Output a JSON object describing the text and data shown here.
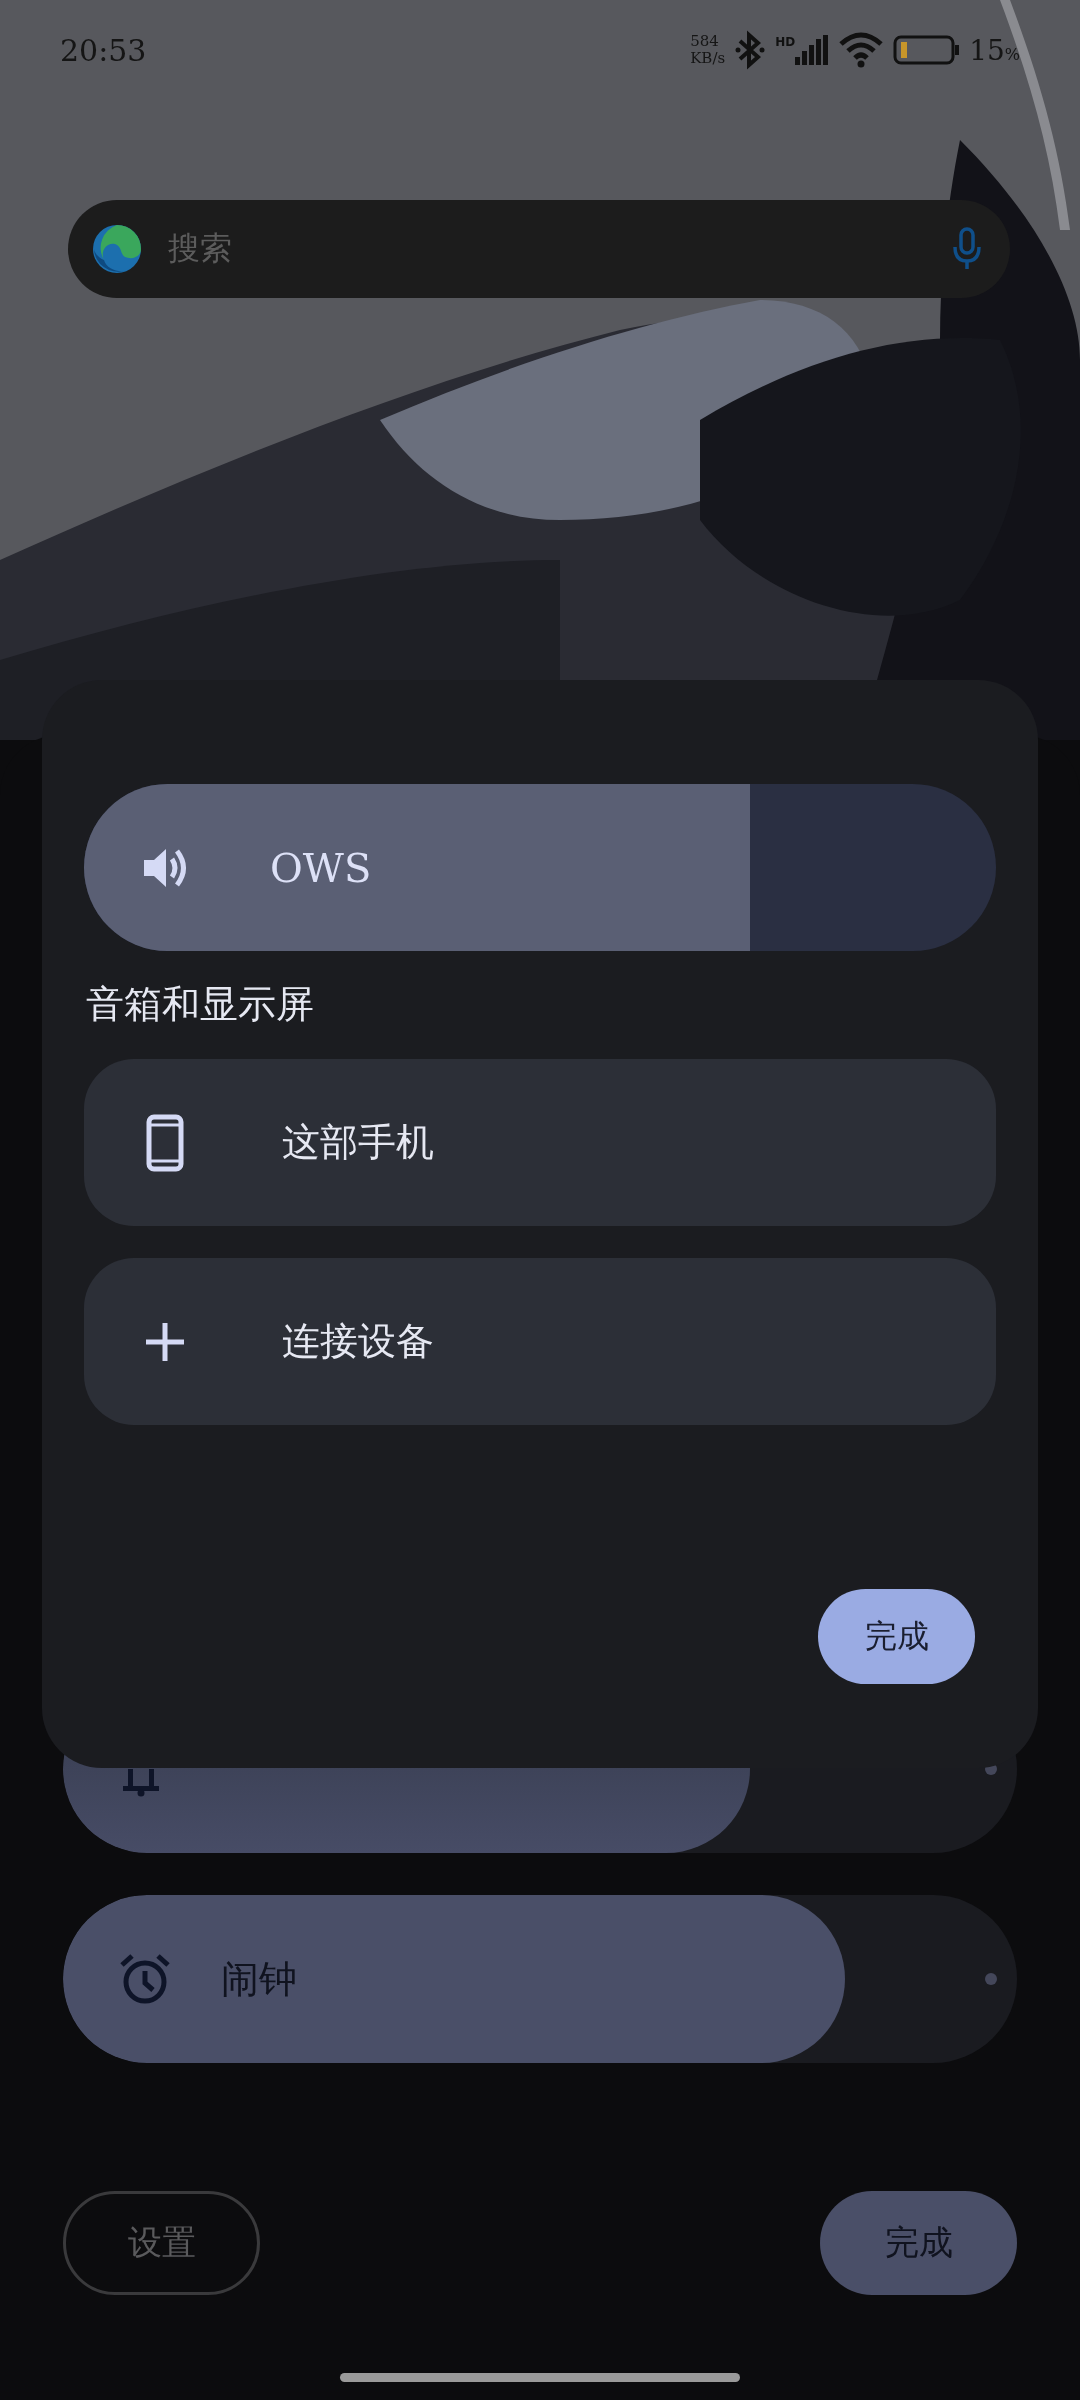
{
  "status_bar": {
    "time": "20:53",
    "net_speed": [
      "584",
      "KB/s"
    ],
    "signal_label": "HD",
    "battery": "15",
    "battery_unit": "%"
  },
  "search": {
    "placeholder": "搜索"
  },
  "volume_panel": {
    "sliders": [
      {
        "level": 0.72,
        "kind": "bell"
      },
      {
        "label": "闹钟",
        "level": 0.82,
        "kind": "alarm"
      }
    ],
    "buttons": [
      {
        "label": "设置",
        "kind": "outline"
      },
      {
        "label": "完成",
        "kind": "filled"
      }
    ]
  },
  "output_dialog": {
    "current": {
      "label": "OWS",
      "level": 0.73
    },
    "section_title": "音箱和显示屏",
    "devices": [
      {
        "label": "这部手机",
        "kind": "phone"
      },
      {
        "label": "连接设备",
        "kind": "add"
      }
    ],
    "done": "完成"
  }
}
